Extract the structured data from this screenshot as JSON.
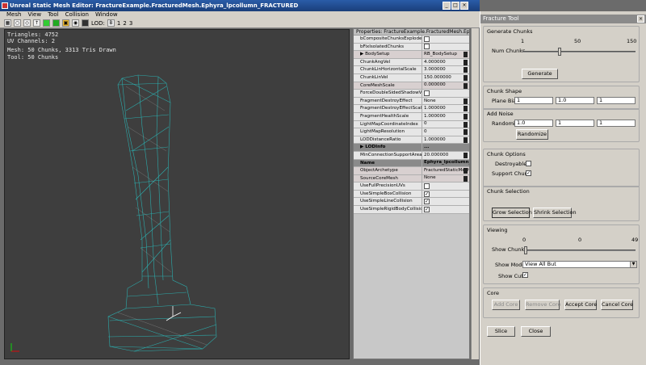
{
  "window": {
    "title": "Unreal Static Mesh Editor: FractureExample.FracturedMesh.Ephyra_lpcollumn_FRACTURED"
  },
  "menu": [
    "Mesh",
    "View",
    "Tool",
    "Collision",
    "Window"
  ],
  "toolbar": {
    "lod_label": "LOD:",
    "lod_items": [
      "B",
      "1",
      "2",
      "3"
    ]
  },
  "viewport": {
    "triangles": "Triangles:  4752",
    "uv_channels": "UV Channels:  2",
    "mesh_info": "Mesh: 50 Chunks, 3313 Tris Drawn",
    "tool_info": "Tool: 50 Chunks"
  },
  "properties": {
    "title": "Properties: FractureExample.FracturedMesh.Ephyra_lp...",
    "rows": [
      {
        "name": "bCompositeChunksExplodeOnIm",
        "value": "",
        "check": true,
        "checked": false
      },
      {
        "name": "bFixIsolatedChunks",
        "value": "",
        "check": true,
        "checked": false
      },
      {
        "name": "▶ BodySetup",
        "value": "RB_BodySetup",
        "style": "alt"
      },
      {
        "name": "ChunkAngVel",
        "value": "4.000000"
      },
      {
        "name": "ChunkLinHorizontalScale",
        "value": "3.000000"
      },
      {
        "name": "ChunkLinVel",
        "value": "150.000000"
      },
      {
        "name": "CoreMeshScale",
        "value": "0.000000",
        "style": "alt"
      },
      {
        "name": "ForceDoubleSidedShadowVolume",
        "value": "",
        "check": true,
        "checked": false
      },
      {
        "name": "FragmentDestroyEffect",
        "value": "None"
      },
      {
        "name": "FragmentDestroyEffectScale",
        "value": "1.000000"
      },
      {
        "name": "FragmentHealthScale",
        "value": "1.000000"
      },
      {
        "name": "LightMapCoordinateIndex",
        "value": "0"
      },
      {
        "name": "LightMapResolution",
        "value": "0"
      },
      {
        "name": "LODDistanceRatio",
        "value": "1.000000"
      },
      {
        "name": "▶ LODInfo",
        "value": "...",
        "style": "dark"
      },
      {
        "name": "MinConnectionSupportArea",
        "value": "20.000000"
      },
      {
        "name": "Name",
        "value": "Ephyra_lpcollumn_",
        "style": "dark"
      },
      {
        "name": "ObjectArchetype",
        "value": "FracturedStaticMesh",
        "style": "alt"
      },
      {
        "name": "SourceCoreMesh",
        "value": "None",
        "style": "alt"
      },
      {
        "name": "UseFullPrecisionUVs",
        "value": "",
        "check": true,
        "checked": false
      },
      {
        "name": "UseSimpleBoxCollision",
        "value": "",
        "check": true,
        "checked": true
      },
      {
        "name": "UseSimpleLineCollision",
        "value": "",
        "check": true,
        "checked": true
      },
      {
        "name": "UseSimpleRigidBodyCollision",
        "value": "",
        "check": true,
        "checked": true
      }
    ]
  },
  "fracture": {
    "title": "Fracture Tool",
    "generate": {
      "group": "Generate Chunks",
      "scale_min": "1",
      "scale_mid": "50",
      "scale_max": "150",
      "label": "Num Chunks",
      "slider_fraction": 0.33,
      "button": "Generate"
    },
    "shape": {
      "group": "Chunk Shape",
      "label": "Plane Bias",
      "values": [
        "1",
        "1.0",
        "1"
      ]
    },
    "noise": {
      "group": "Add Noise",
      "label": "Randomize",
      "values": [
        "1.0",
        "1",
        "1"
      ],
      "button": "Randomize"
    },
    "options": {
      "group": "Chunk Options",
      "destroyable": "Destroyable",
      "destroyable_checked": false,
      "support": "Support Chunk",
      "support_checked": true
    },
    "selection": {
      "group": "Chunk Selection",
      "grow": "Grow Selection",
      "shrink": "Shrink Selection"
    },
    "viewing": {
      "group": "Viewing",
      "scale_min": "0",
      "scale_mid": "0",
      "scale_max": "49",
      "show_chunks": "Show Chunks",
      "slider_fraction": 0.0,
      "show_mode": "Show Mode",
      "mode_value": "View All But",
      "show_cuts": "Show Cuts",
      "show_cuts_checked": true
    },
    "core": {
      "group": "Core",
      "add": "Add Core",
      "remove": "Remove Core",
      "accept": "Accept Core",
      "cancel": "Cancel Core"
    },
    "slice": "Slice",
    "close": "Close"
  }
}
